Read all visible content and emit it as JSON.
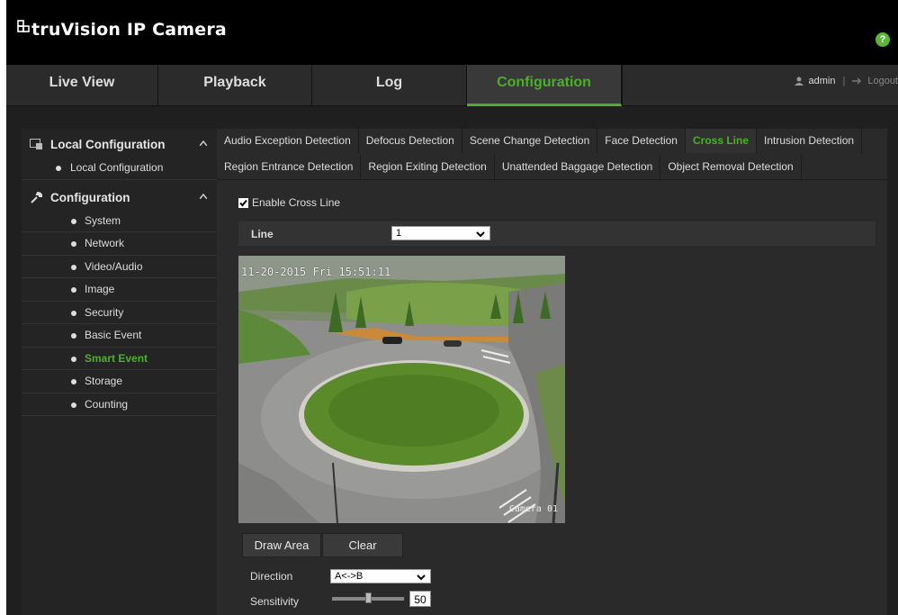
{
  "app": {
    "brand": "truVision IP Camera",
    "help_label": "?"
  },
  "nav": {
    "tabs": [
      "Live View",
      "Playback",
      "Log",
      "Configuration"
    ],
    "active": "Configuration"
  },
  "user": {
    "name": "admin",
    "separator": "|",
    "logout": "Logout"
  },
  "sidebar": {
    "groups": [
      {
        "label": "Local Configuration",
        "icon": "local-config-icon",
        "items": [
          "Local Configuration"
        ]
      },
      {
        "label": "Configuration",
        "icon": "wrench-icon",
        "items": [
          "System",
          "Network",
          "Video/Audio",
          "Image",
          "Security",
          "Basic Event",
          "Smart Event",
          "Storage",
          "Counting"
        ]
      }
    ],
    "active_item": "Smart Event"
  },
  "tabs": {
    "row1": [
      "Audio Exception Detection",
      "Defocus Detection",
      "Scene Change Detection",
      "Face Detection",
      "Cross Line",
      "Intrusion Detection"
    ],
    "row2": [
      "Region Entrance Detection",
      "Region Exiting Detection",
      "Unattended Baggage Detection",
      "Object Removal Detection"
    ],
    "active": "Cross Line"
  },
  "form": {
    "enable_label": "Enable Cross Line",
    "enable_checked": true,
    "line_label": "Line",
    "line_value": "1",
    "osd_time": "11-20-2015  Fri 15:51:11",
    "osd_camera": "Camera 01",
    "draw_area": "Draw Area",
    "clear": "Clear",
    "direction_label": "Direction",
    "direction_value": "A<->B",
    "sensitivity_label": "Sensitivity",
    "sensitivity_value": "50",
    "sensitivity_fraction": 0.5
  },
  "colors": {
    "accent": "#4caf2a",
    "background": "#1f1f1f",
    "help_badge": "#5bb834"
  }
}
